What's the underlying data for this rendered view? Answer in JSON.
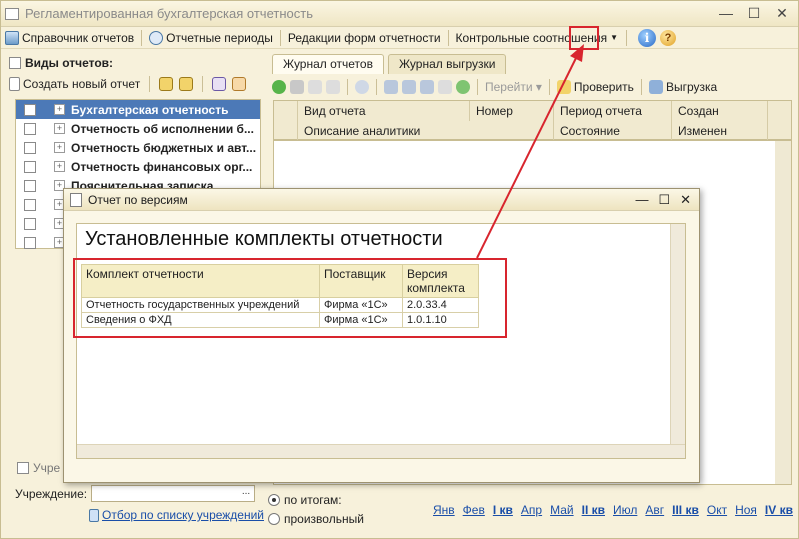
{
  "window": {
    "title": "Регламентированная бухгалтерская отчетность"
  },
  "toolbar": {
    "reports_ref": "Справочник отчетов",
    "periods": "Отчетные периоды",
    "form_editions": "Редакции форм отчетности",
    "control": "Контрольные соотношения",
    "info_icon": "i",
    "help_icon": "?"
  },
  "left": {
    "header": "Виды отчетов:",
    "create_new": "Создать новый отчет",
    "items": [
      {
        "label": "Бухгалтерская отчетность",
        "selected": true
      },
      {
        "label": "Отчетность об исполнении б..."
      },
      {
        "label": "Отчетность бюджетных и авт..."
      },
      {
        "label": "Отчетность финансовых орг..."
      },
      {
        "label": "Пояснительная записка"
      },
      {
        "label": ""
      },
      {
        "label": ""
      },
      {
        "label": ""
      }
    ],
    "bottom_checkbox": "Учре",
    "institution_label": "Учреждение:",
    "institution_btn": "...",
    "filter_link": "Отбор по списку учреждений"
  },
  "right": {
    "tabs": [
      "Журнал отчетов",
      "Журнал выгрузки"
    ],
    "toolbar": {
      "goto": "Перейти",
      "check": "Проверить",
      "export": "Выгрузка"
    },
    "grid_head_row1": [
      "Вид отчета",
      "Номер",
      "Период отчета",
      "Создан"
    ],
    "grid_head_row2": [
      "Описание аналитики",
      "Состояние",
      "Изменен"
    ],
    "radio_totals": "по итогам:",
    "radio_custom": "произвольный",
    "periods": [
      "Янв",
      "Фев",
      "I кв",
      "Апр",
      "Май",
      "II кв",
      "Июл",
      "Авг",
      "III кв",
      "Окт",
      "Ноя",
      "IV кв"
    ]
  },
  "dialog": {
    "title": "Отчет по версиям",
    "heading": "Установленные комплекты отчетности",
    "columns": [
      "Комплект отчетности",
      "Поставщик",
      "Версия комплекта"
    ],
    "rows": [
      [
        "Отчетность государственных учреждений",
        "Фирма «1С»",
        "2.0.33.4"
      ],
      [
        "Сведения о ФХД",
        "Фирма «1С»",
        "1.0.1.10"
      ]
    ]
  },
  "colors": {
    "highlight": "#d8252e",
    "selection": "#4c79b7",
    "link": "#1a4ea8"
  }
}
